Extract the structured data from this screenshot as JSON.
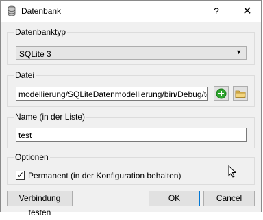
{
  "window": {
    "title": "Datenbank",
    "help": "?",
    "close": "✕"
  },
  "db_type": {
    "group_label": "Datenbanktyp",
    "selected": "SQLite 3"
  },
  "file": {
    "group_label": "Datei",
    "value": "modellierung/SQLiteDatenmodellierung/bin/Debug/test.db"
  },
  "name": {
    "group_label": "Name (in der Liste)",
    "value": "test"
  },
  "options": {
    "group_label": "Optionen",
    "permanent_label": "Permanent (in der Konfiguration behalten)",
    "permanent_checked": true
  },
  "buttons": {
    "test": "Verbindung testen",
    "ok": "OK",
    "cancel": "Cancel"
  },
  "colors": {
    "add_green": "#2fa52f",
    "folder_yellow": "#e8c15a"
  }
}
